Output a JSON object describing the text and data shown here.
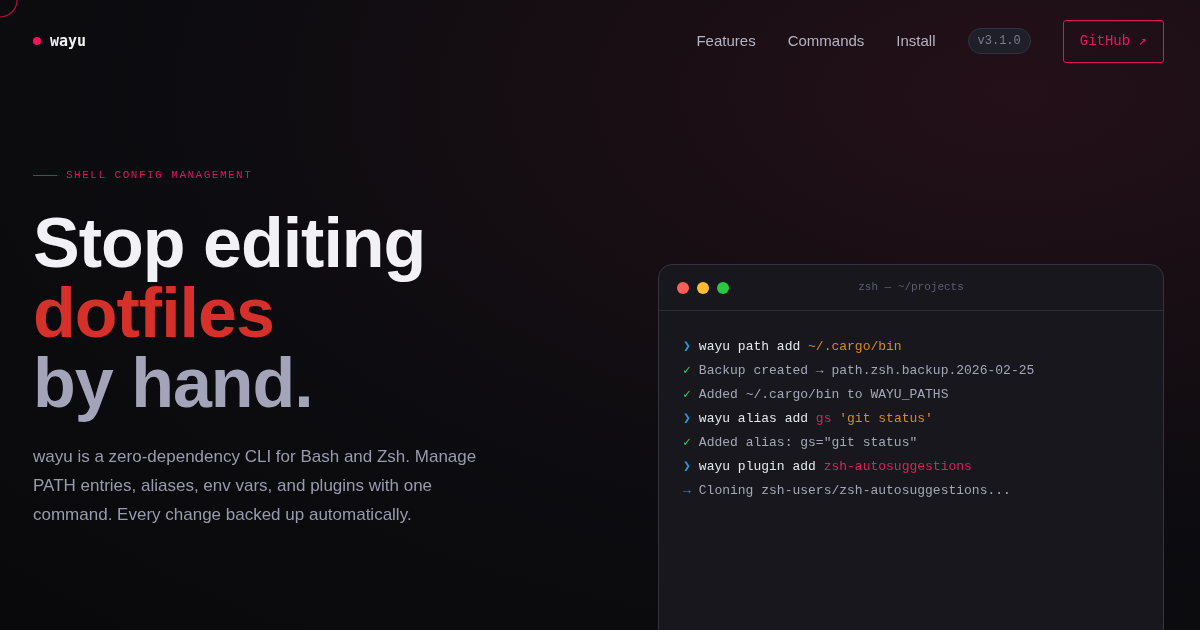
{
  "brand": {
    "name": "wayu"
  },
  "nav": {
    "links": [
      "Features",
      "Commands",
      "Install"
    ],
    "version": "v3.1.0",
    "github": "GitHub ↗"
  },
  "hero": {
    "eyebrow": "SHELL CONFIG MANAGEMENT",
    "headline": [
      {
        "text": "Stop editing",
        "color": "#f2f2f6"
      },
      {
        "text": "dotfiles",
        "color": "#d6302a"
      },
      {
        "text": "by hand.",
        "color": "#a3a3ba"
      }
    ],
    "description": "wayu is a zero-dependency CLI for Bash and Zsh. Manage PATH entries, aliases, env vars, and plugins with one command. Every change backed up automatically."
  },
  "terminal": {
    "title": "zsh — ~/projects",
    "lines": [
      {
        "kind": "prompt",
        "marker": "❯",
        "parts": [
          {
            "text": "wayu path add ",
            "color": "#e6e6ee"
          },
          {
            "text": "~/.cargo/bin",
            "color": "#d98a1e"
          }
        ]
      },
      {
        "kind": "ok",
        "marker": "✓",
        "parts": [
          {
            "text": "Backup created → path.zsh.backup.2026-02-25",
            "color": "#a6a6b6"
          }
        ]
      },
      {
        "kind": "ok",
        "marker": "✓",
        "parts": [
          {
            "text": "Added ~/.cargo/bin to WAYU_PATHS",
            "color": "#a6a6b6"
          }
        ]
      },
      {
        "kind": "prompt",
        "marker": "❯",
        "parts": [
          {
            "text": "wayu alias add ",
            "color": "#e6e6ee"
          },
          {
            "text": "gs",
            "color": "#e0205a"
          },
          {
            "text": " 'git status'",
            "color": "#d98a1e"
          }
        ]
      },
      {
        "kind": "ok",
        "marker": "✓",
        "parts": [
          {
            "text": "Added alias: gs=\"git status\"",
            "color": "#a6a6b6"
          }
        ]
      },
      {
        "kind": "prompt",
        "marker": "❯",
        "parts": [
          {
            "text": "wayu plugin add ",
            "color": "#e6e6ee"
          },
          {
            "text": "zsh-autosuggestions",
            "color": "#e0205a"
          }
        ]
      },
      {
        "kind": "info",
        "marker": "→",
        "parts": [
          {
            "text": "Cloning zsh-users/zsh-autosuggestions...",
            "color": "#a6a6b6"
          }
        ]
      }
    ]
  }
}
